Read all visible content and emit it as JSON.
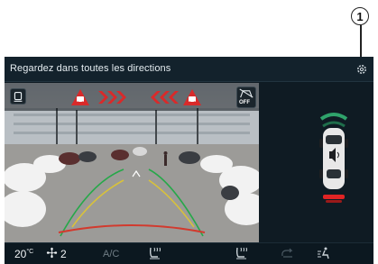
{
  "callout": {
    "number": "1"
  },
  "header": {
    "title": "Regardez dans toutes les directions",
    "settings_icon": "gear-icon"
  },
  "camera": {
    "left_icon": "camera-view-icon",
    "warning_icons": [
      "cross-traffic-warning-icon",
      "cross-traffic-warning-icon"
    ],
    "arrows": [
      "chevrons-right-icon",
      "chevrons-left-icon"
    ],
    "toggle": {
      "icon": "sensor-toggle-icon",
      "label": "OFF"
    },
    "guide_lines": [
      "green",
      "yellow",
      "red"
    ]
  },
  "side_panel": {
    "car_icon": "parking-sensor-car-icon",
    "sensor_zones": [
      "front",
      "rear"
    ]
  },
  "climate": {
    "temperature": "20",
    "temperature_unit": "°C",
    "fan_icon": "fan-icon",
    "fan_speed": "2",
    "ac_label": "A/C",
    "ac_active": false,
    "icons": [
      "heated-seat-icon",
      "heated-seat-icon",
      "air-recirculation-icon",
      "air-distribution-icon"
    ]
  },
  "colors": {
    "warning_red": "#d92a2a",
    "sensor_green": "#2fa36b",
    "sensor_red": "#e02424"
  }
}
